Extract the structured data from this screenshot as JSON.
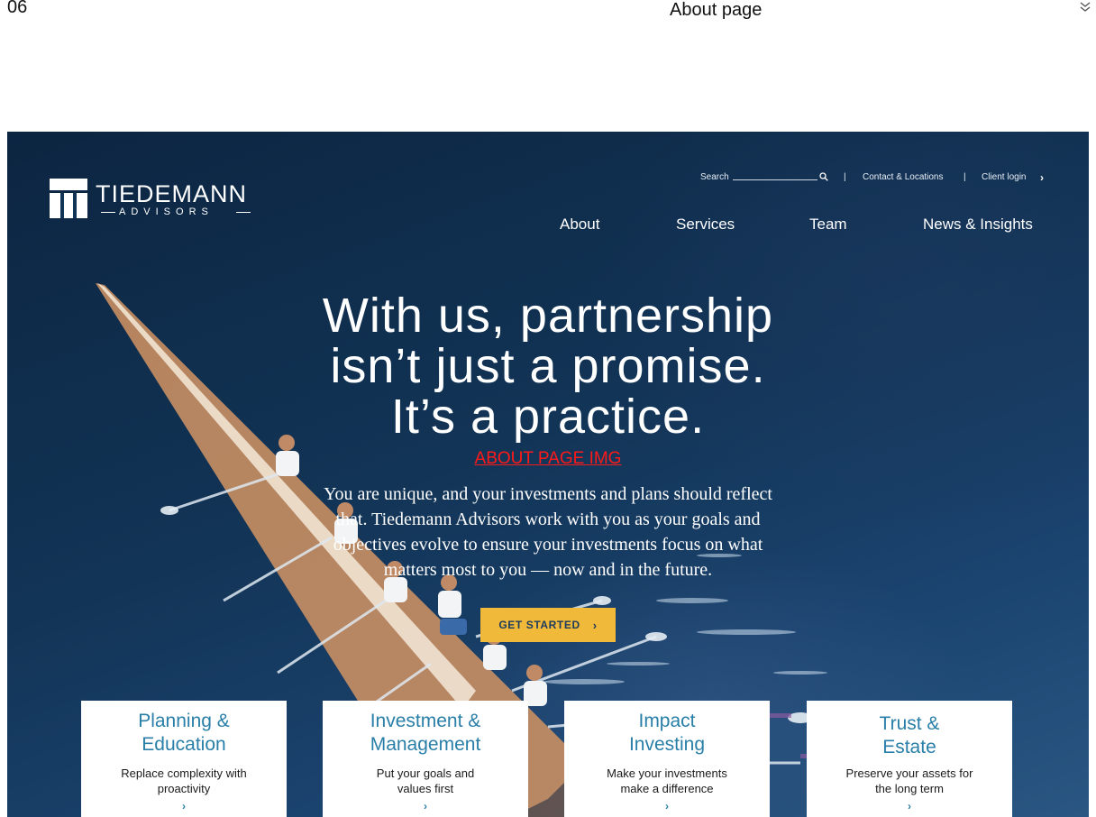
{
  "page_header": {
    "page_number": "06",
    "page_label": "About page",
    "collapse_icon": "double-chevron-down-icon"
  },
  "site": {
    "brand_name": "TIEDEMANN",
    "brand_sub": "ADVISORS",
    "utility": {
      "search_label": "Search",
      "search_placeholder": "",
      "separator": "|",
      "contact_label": "Contact & Locations",
      "login_label": "Client login",
      "login_chevron": "›"
    },
    "nav": [
      "About",
      "Services",
      "Team",
      "News & Insights"
    ],
    "headline_lines": [
      "With us, partnership",
      "isn’t just a promise.",
      "It’s a practice."
    ],
    "image_placeholder": "ABOUT PAGE IMG",
    "body_lines": [
      "You are unique, and your investments and plans should reflect",
      "that. Tiedemann Advisors work with you as your goals and",
      "objectives evolve to ensure your investments focus on what",
      "matters most to you — now and in the future."
    ],
    "cta_label": "GET STARTED",
    "cta_chevron": "›",
    "cards": [
      {
        "title": [
          "Planning &",
          "Education"
        ],
        "desc": [
          "Replace complexity with",
          "proactivity"
        ],
        "chevron": "›"
      },
      {
        "title": [
          "Investment &",
          "Management"
        ],
        "desc": [
          "Put your goals and",
          "values first"
        ],
        "chevron": "›"
      },
      {
        "title": [
          "Impact",
          "Investing"
        ],
        "desc": [
          "Make your investments",
          "make a difference"
        ],
        "chevron": "›"
      },
      {
        "title": [
          "Trust &",
          "Estate"
        ],
        "desc": [
          "Preserve your assets for",
          "the long term"
        ],
        "chevron": "›"
      }
    ]
  },
  "colors": {
    "accent_gold": "#f0b93a",
    "card_title_blue": "#2a7fa8",
    "hero_navy": "#123456",
    "placeholder_red": "#ff1a1a"
  }
}
